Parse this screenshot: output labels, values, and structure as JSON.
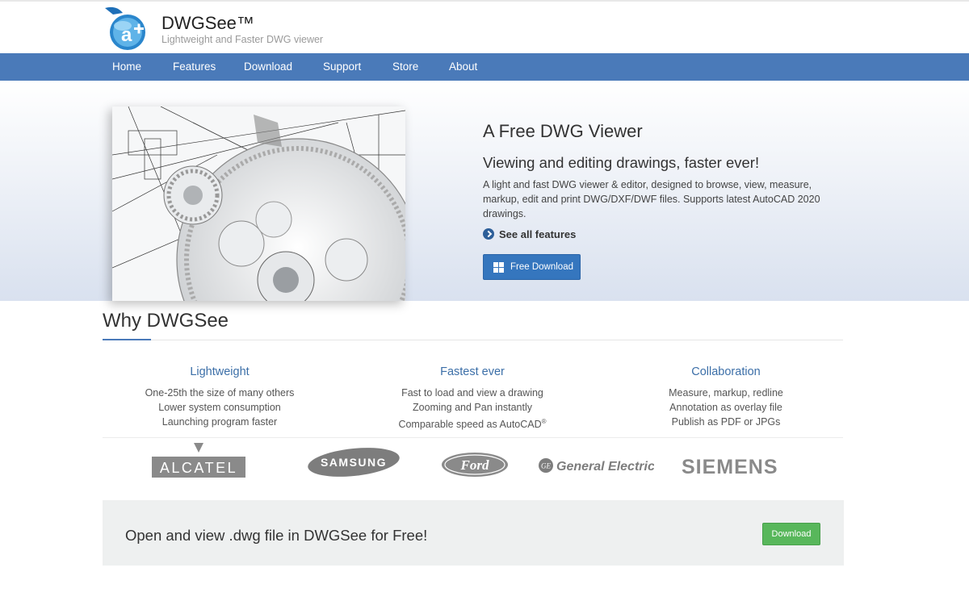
{
  "brand": {
    "name": "DWGSee™",
    "tagline": "Lightweight and Faster DWG viewer",
    "logo_letter": "a"
  },
  "nav": [
    {
      "label": "Home"
    },
    {
      "label": "Features"
    },
    {
      "label": "Download"
    },
    {
      "label": "Support"
    },
    {
      "label": "Store"
    },
    {
      "label": "About"
    }
  ],
  "hero": {
    "title": "A Free DWG Viewer",
    "subtitle": "Viewing and editing drawings, faster ever!",
    "description": "A light and fast DWG viewer & editor, designed to browse, view, measure, markup, edit and print DWG/DXF/DWF files. Supports latest AutoCAD 2020 drawings.",
    "see_all": "See all features",
    "button": "Free Download",
    "image": "gear-cad-drawing"
  },
  "why": {
    "title": "Why DWGSee",
    "columns": [
      {
        "title": "Lightweight",
        "lines": [
          "One-25th the size of many others",
          "Lower system consumption",
          "Launching program faster"
        ]
      },
      {
        "title": "Fastest ever",
        "lines": [
          "Fast to load and view a drawing",
          "Zooming and Pan instantly",
          "Comparable speed as AutoCAD"
        ],
        "mark": "®"
      },
      {
        "title": "Collaboration",
        "lines": [
          "Measure, markup, redline",
          "Annotation as overlay file",
          "Publish as PDF or JPGs"
        ]
      }
    ]
  },
  "logos": {
    "alcatel": "ALCATEL",
    "samsung": "SAMSUNG",
    "ford": "Ford",
    "ge": "General Electric",
    "ge_mark": "GE",
    "siemens": "SIEMENS"
  },
  "cta": {
    "text": "Open and view .dwg file in DWGSee for Free!",
    "button": "Download"
  },
  "colors": {
    "nav": "#4a7ab9",
    "primary_button": "#3576be",
    "download_button": "#58b75b",
    "heading_blue": "#3c6fa8"
  }
}
